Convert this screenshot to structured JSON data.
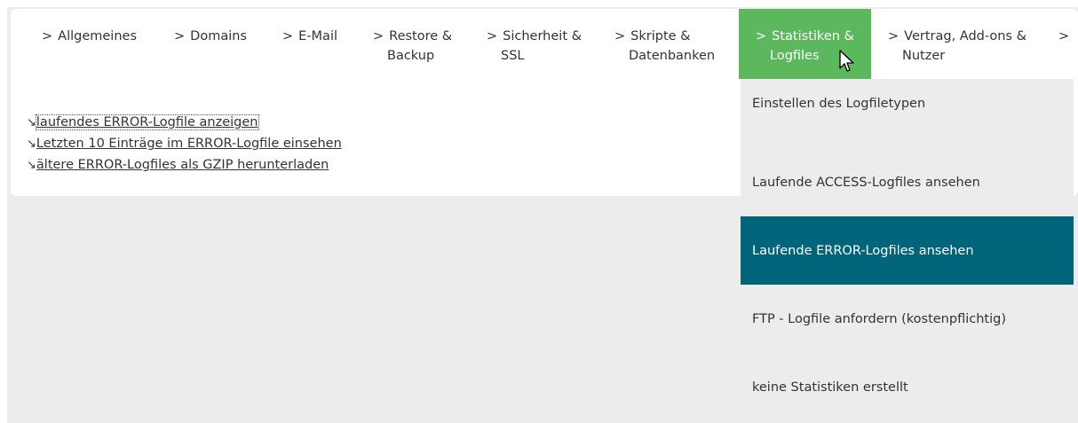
{
  "nav": {
    "items": [
      {
        "label": "Allgemeines"
      },
      {
        "label": "Domains"
      },
      {
        "label": "E-Mail"
      },
      {
        "label": "Restore & Backup",
        "line1": "Restore &",
        "line2": "Backup"
      },
      {
        "label": "Sicherheit & SSL",
        "line1": "Sicherheit &",
        "line2": "SSL"
      },
      {
        "label": "Skripte & Datenbanken",
        "line1": "Skripte &",
        "line2": "Datenbanken"
      },
      {
        "label": "Statistiken & Logfiles",
        "line1": "Statistiken &",
        "line2": "Logfiles",
        "active": true
      },
      {
        "label": "Vertrag, Add-ons & Nutzer",
        "line1": "Vertrag, Add-ons &",
        "line2": "Nutzer"
      }
    ],
    "chevron": ">"
  },
  "links": {
    "arrow": "↘",
    "items": [
      "laufendes ERROR-Logfile anzeigen",
      "Letzten 10 Einträge im ERROR-Logfile einsehen",
      "ältere ERROR-Logfiles als GZIP herunterladen"
    ]
  },
  "dropdown": {
    "items": [
      "Einstellen des Logfiletypen",
      "Laufende ACCESS-Logfiles ansehen",
      "Laufende ERROR-Logfiles ansehen",
      "FTP - Logfile anfordern (kostenpflichtig)",
      "keine Statistiken erstellt"
    ],
    "selected_index": 2
  },
  "colors": {
    "active_tab": "#5cb85c",
    "selected_item": "#00647a",
    "background": "#ececec"
  }
}
